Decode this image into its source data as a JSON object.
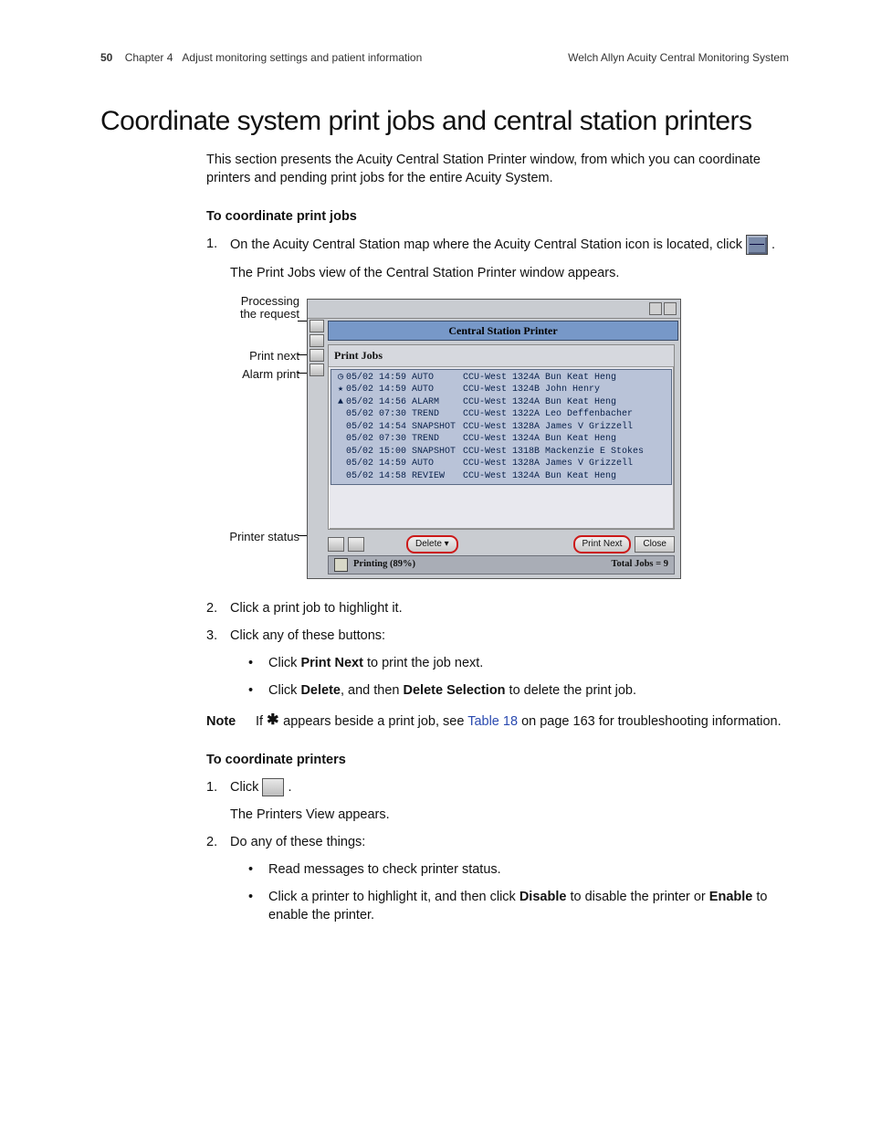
{
  "header": {
    "page_number": "50",
    "chapter": "Chapter 4",
    "chapter_title": "Adjust monitoring settings and patient information",
    "product": "Welch Allyn  Acuity Central Monitoring System"
  },
  "section_title": "Coordinate system print jobs and central station printers",
  "intro": "This section presents the Acuity Central Station Printer window, from which you can coordinate printers and pending print jobs for the entire Acuity System.",
  "sub1": {
    "heading": "To coordinate print jobs",
    "step1a": "On the Acuity Central Station map where the Acuity Central Station icon is located, click ",
    "step1b": ".",
    "step1_result": "The Print Jobs view of the Central Station Printer window appears.",
    "step2": "Click a print job to highlight it.",
    "step3": "Click any of these buttons:",
    "bullet1a": "Click ",
    "bullet1b": "Print Next",
    "bullet1c": " to print the job next.",
    "bullet2a": "Click ",
    "bullet2b": "Delete",
    "bullet2c": ", and then ",
    "bullet2d": "Delete Selection",
    "bullet2e": " to delete the print job."
  },
  "note": {
    "label": "Note",
    "a": "If ",
    "b": " appears beside a print job, see ",
    "link": "Table 18",
    "c": " on page 163 for troubleshooting information."
  },
  "sub2": {
    "heading": "To coordinate printers",
    "step1a": "Click ",
    "step1b": ".",
    "step1_result": "The Printers View appears.",
    "step2": "Do any of these things:",
    "bullet1": "Read messages to check printer status.",
    "bullet2a": "Click a printer to highlight it, and then click ",
    "bullet2b": "Disable",
    "bullet2c": " to disable the printer or ",
    "bullet2d": "Enable",
    "bullet2e": " to enable the printer."
  },
  "figure": {
    "labels": {
      "processing": "Processing\nthe request",
      "print_next": "Print next",
      "alarm_print": "Alarm print",
      "printer_status": "Printer status"
    },
    "window_title": "Central Station Printer",
    "panel_title": "Print Jobs",
    "jobs": [
      {
        "icon": "clock",
        "c1": "05/02 14:59 AUTO",
        "c2": "CCU-West 1324A Bun Keat Heng"
      },
      {
        "icon": "star",
        "c1": "05/02 14:59 AUTO",
        "c2": "CCU-West 1324B John Henry"
      },
      {
        "icon": "bell",
        "c1": "05/02 14:56 ALARM",
        "c2": "CCU-West 1324A Bun Keat Heng"
      },
      {
        "icon": "",
        "c1": "05/02 07:30 TREND",
        "c2": "CCU-West 1322A Leo Deffenbacher"
      },
      {
        "icon": "",
        "c1": "05/02 14:54 SNAPSHOT",
        "c2": "CCU-West 1328A James V Grizzell"
      },
      {
        "icon": "",
        "c1": "05/02 07:30 TREND",
        "c2": "CCU-West 1324A Bun Keat Heng"
      },
      {
        "icon": "",
        "c1": "05/02 15:00 SNAPSHOT",
        "c2": "CCU-West 1318B Mackenzie E Stokes"
      },
      {
        "icon": "",
        "c1": "05/02 14:59 AUTO",
        "c2": "CCU-West 1328A James V Grizzell"
      },
      {
        "icon": "",
        "c1": "05/02 14:58 REVIEW",
        "c2": "CCU-West 1324A Bun Keat Heng"
      }
    ],
    "buttons": {
      "delete": "Delete  ▾",
      "print_next": "Print Next",
      "close": "Close"
    },
    "status": {
      "printing": "Printing (89%)",
      "total": "Total Jobs = 9"
    }
  }
}
